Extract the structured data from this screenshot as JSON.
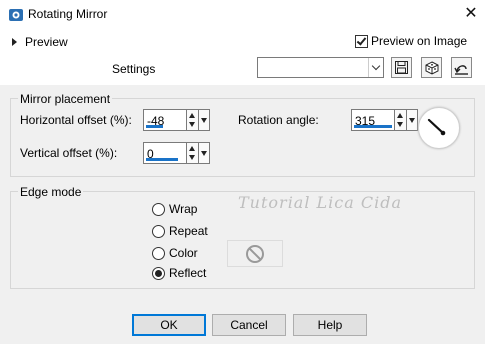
{
  "window": {
    "title": "Rotating Mirror",
    "close_glyph": "✕"
  },
  "top": {
    "preview_label": "Preview",
    "preview_on_image_label": "Preview on Image",
    "preview_on_image_checked": true,
    "settings_label": "Settings",
    "settings_value": ""
  },
  "mirror_placement": {
    "title": "Mirror placement",
    "horizontal_offset_label": "Horizontal offset (%):",
    "horizontal_offset_value": "-48",
    "vertical_offset_label": "Vertical offset (%):",
    "vertical_offset_value": "0",
    "rotation_angle_label": "Rotation angle:",
    "rotation_angle_value": "315"
  },
  "edge_mode": {
    "title": "Edge mode",
    "options": [
      "Wrap",
      "Repeat",
      "Color",
      "Reflect"
    ],
    "selected": "Reflect"
  },
  "watermark": "Tutorial Lica Cida",
  "buttons": {
    "ok": "OK",
    "cancel": "Cancel",
    "help": "Help"
  },
  "colors": {
    "accent": "#0078d7",
    "spin_bar": "#1a73c8",
    "panel_bg": "#f0f0f0"
  },
  "icons": {
    "app": "rotating-mirror-icon",
    "save": "save-icon",
    "random": "dice-icon",
    "reset": "reset-icon",
    "no_color": "no-color-icon"
  }
}
